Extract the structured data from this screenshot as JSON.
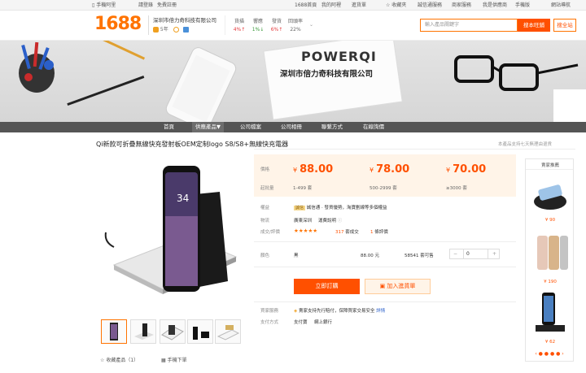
{
  "topbar": {
    "mobile": "手機阿里",
    "login": "請登錄",
    "register": "免費註冊",
    "home": "1688首頁",
    "my_aliba": "我的阿裡",
    "purchase": "進貨單",
    "favorites": "收藏夾",
    "buyer_center": "誠信通服務",
    "merchant": "商家服務",
    "my_report": "我是供應商",
    "mobile_version": "手機版",
    "site_nav": "網站導航"
  },
  "header": {
    "logo": "1688",
    "shop_name": "深圳市倍力奇科技有限公司",
    "years": "5年",
    "stats": [
      {
        "label": "貨描",
        "value": "4%↑"
      },
      {
        "label": "響應",
        "value": "1%↓"
      },
      {
        "label": "發貨",
        "value": "6%↑"
      },
      {
        "label": "回頭率",
        "value": "22%"
      }
    ],
    "search_placeholder": "輸入產品關鍵字",
    "search_shop_button": "搜本旺鋪",
    "search_all_button": "搜全站"
  },
  "banner": {
    "brand": "POWERQI",
    "company": "深圳市倍力奇科技有限公司"
  },
  "nav": {
    "items": [
      "首頁",
      "供應產品▼",
      "公司檔案",
      "公司相冊",
      "聯繫方式",
      "在線詢價"
    ]
  },
  "product": {
    "title": "Qi新款可折疊無線快充發射板OEM定制logo S8/S8+無線快充電器",
    "report": "本產品支持七天無理由退貨",
    "prices": [
      {
        "amount": "88.00",
        "range": "1-499 套"
      },
      {
        "amount": "78.00",
        "range": "500-2999 套"
      },
      {
        "amount": "70.00",
        "range": "≥3000 套"
      }
    ],
    "price_label": "價格",
    "moq_label": "起批量",
    "currency": "¥",
    "guarantee_label": "權益",
    "guarantee_value": "誠信通 · 發貨優勢，淘寶劃線等多個權益",
    "guarantee_badge": "誠信",
    "logistics_label": "物流",
    "logistics_from": "廣東深圳",
    "logistics_to": "運費說明",
    "reviews_label": "成交/評價",
    "stars": "★★★★★",
    "deals_count": "317",
    "deals_unit": "套成交",
    "review_count": "1",
    "review_unit": "條評價",
    "color_label": "顏色",
    "color_value": "黑",
    "color_price": "88.00 元",
    "stock": "58541 套可售",
    "quantity": "0",
    "minus": "−",
    "plus": "+",
    "order_button": "立即訂購",
    "cart_button": "加入進貨單",
    "service_label": "買家服務",
    "service_value": "賣家支持先行賠付，保障買家交易安全",
    "service_link": "詳情",
    "payment_label": "支付方式",
    "payment_value1": "支付寶",
    "payment_value2": "網上銀行",
    "favorite": "收藏產品（1）",
    "share": "手機下單"
  },
  "sidebar": {
    "title": "賣家推薦",
    "items": [
      {
        "price": "¥ 90"
      },
      {
        "price": "¥ 190"
      },
      {
        "price": "¥ 62"
      }
    ],
    "dots": "‹ ● ● ● ● ›"
  },
  "colors": {
    "accent": "#ff5000",
    "brand_orange": "#ff7300",
    "nav_bg": "#555555",
    "price_bg": "#fff4e8"
  }
}
